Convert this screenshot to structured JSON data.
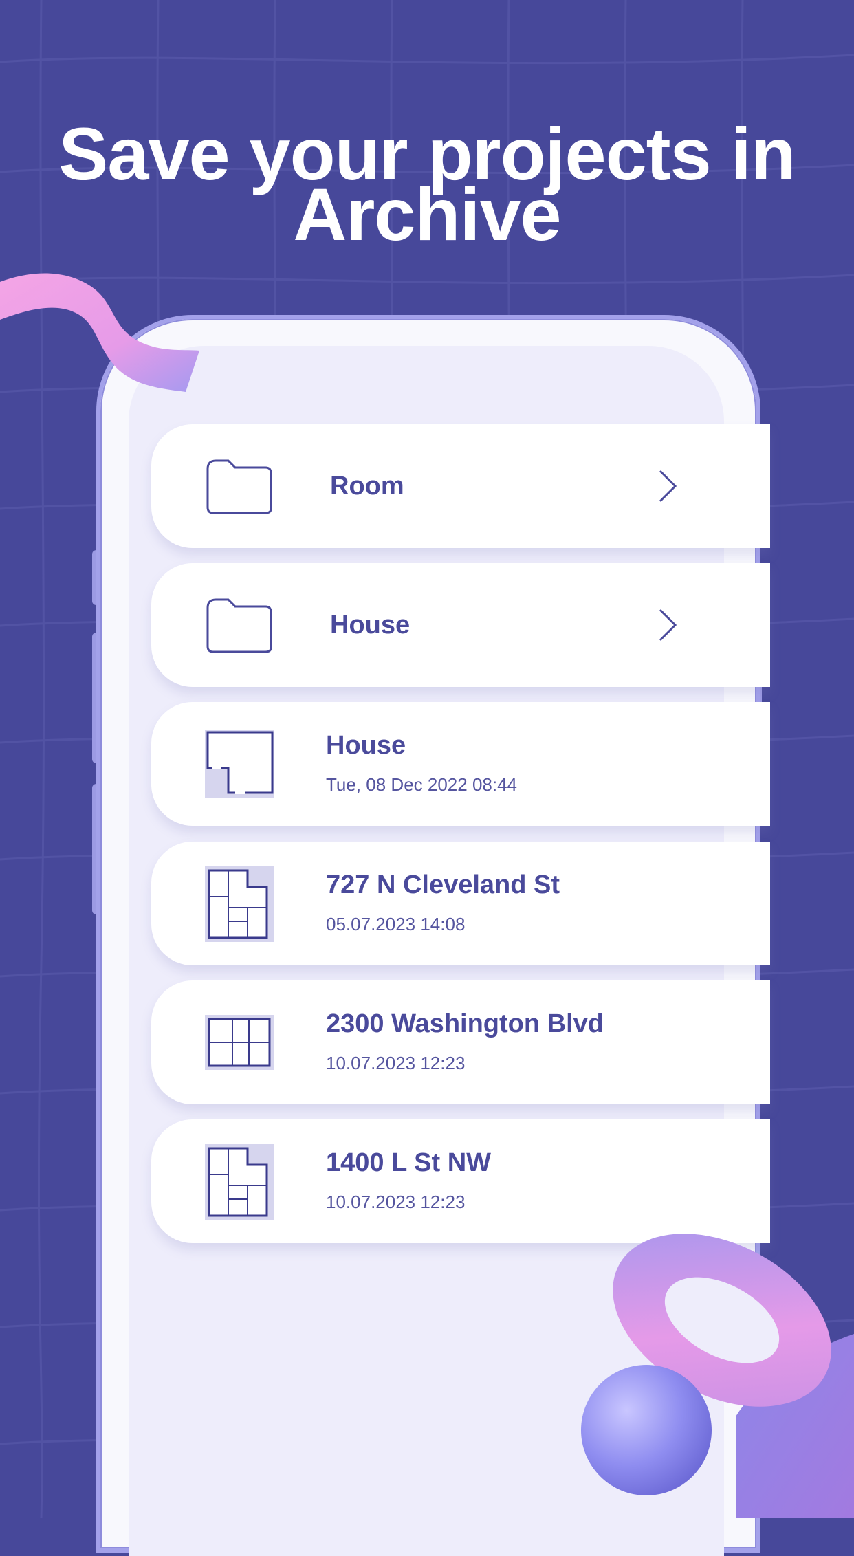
{
  "headline": {
    "line1": "Save your projects in",
    "line2": "Archive"
  },
  "colors": {
    "background": "#47489a",
    "accent": "#4a4a9b",
    "card": "#ffffff",
    "screen": "#eeedfb"
  },
  "archive": {
    "folders": [
      {
        "label": "Room",
        "icon": "folder-icon",
        "action_icon": "chevron-right-icon"
      },
      {
        "label": "House",
        "icon": "folder-icon",
        "action_icon": "chevron-right-icon"
      }
    ],
    "projects": [
      {
        "title": "House",
        "date": "Tue, 08 Dec 2022 08:44",
        "icon": "floorplan-icon"
      },
      {
        "title": "727 N Cleveland St",
        "date": "05.07.2023 14:08",
        "icon": "floorplan-icon"
      },
      {
        "title": "2300 Washington Blvd",
        "date": "10.07.2023 12:23",
        "icon": "floorplan-icon"
      },
      {
        "title": "1400 L St NW",
        "date": "10.07.2023 12:23",
        "icon": "floorplan-icon"
      }
    ]
  }
}
